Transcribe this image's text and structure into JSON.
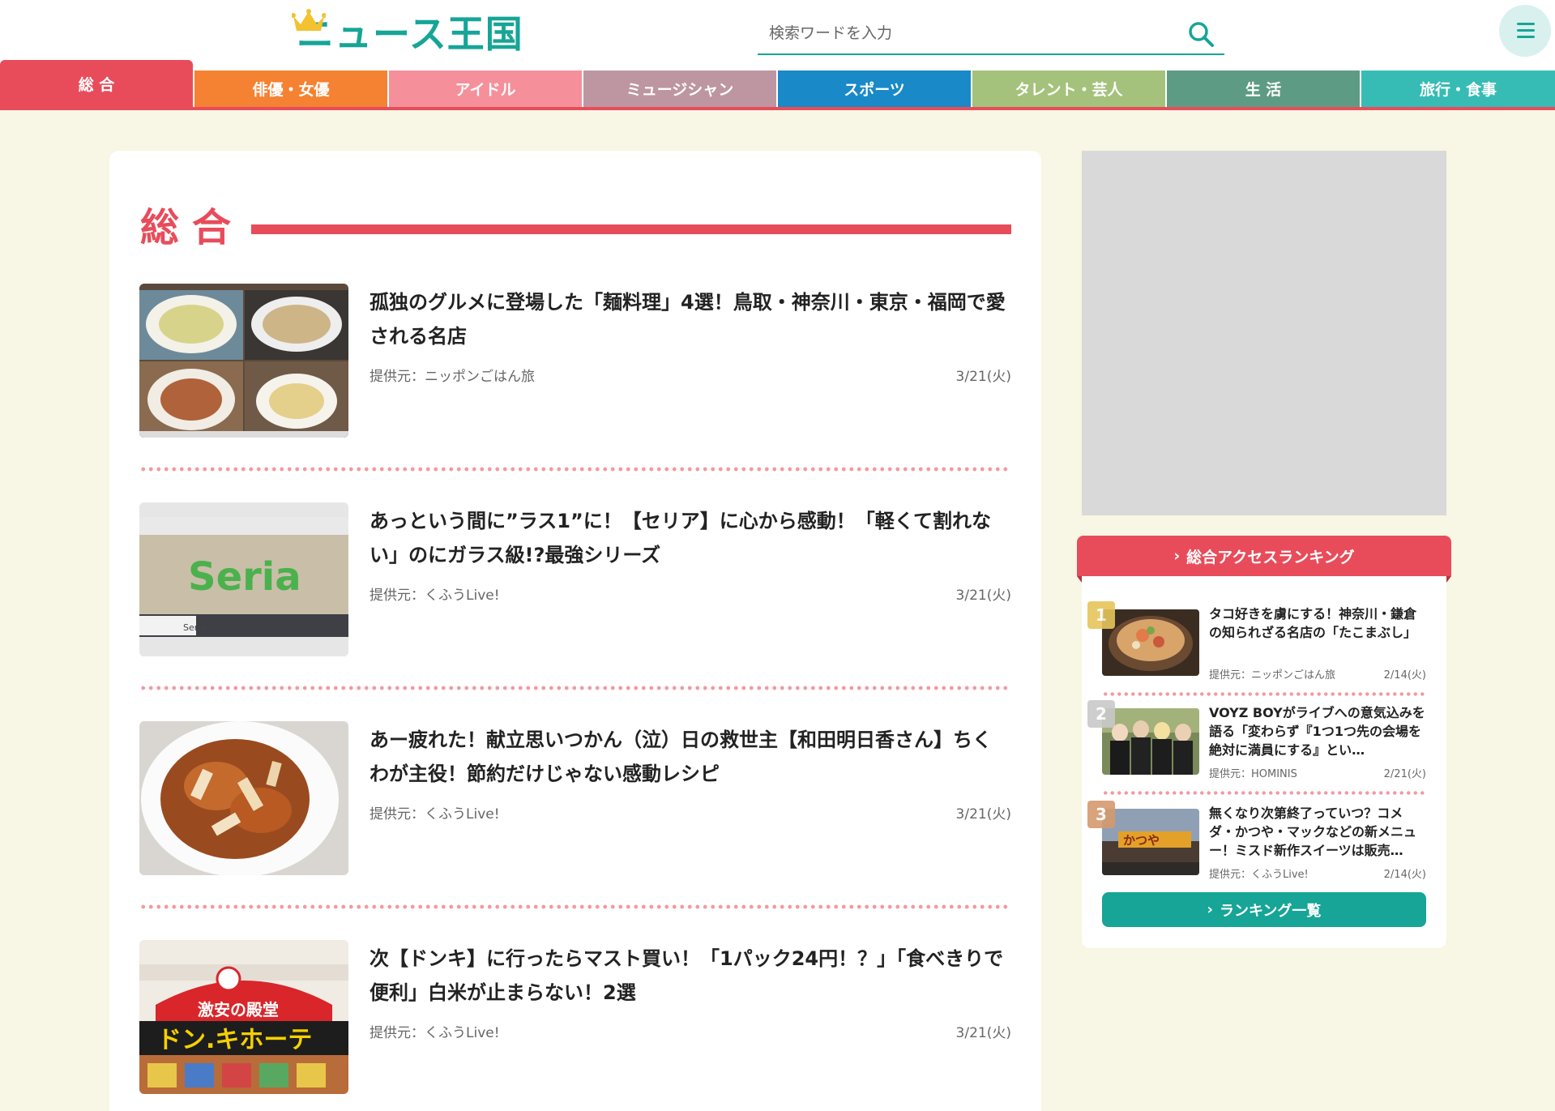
{
  "logo": {
    "text": "ニュース王国",
    "crown_color": "#f2c230"
  },
  "search": {
    "placeholder": "検索ワードを入力"
  },
  "nav": {
    "tabs": [
      {
        "label": "総 合",
        "color": "#e84c5a",
        "active": true
      },
      {
        "label": "俳優・女優",
        "color": "#f58232"
      },
      {
        "label": "アイドル",
        "color": "#f5909b"
      },
      {
        "label": "ミュージシャン",
        "color": "#bd96a1"
      },
      {
        "label": "スポーツ",
        "color": "#1989c7"
      },
      {
        "label": "タレント・芸人",
        "color": "#a4c27c"
      },
      {
        "label": "生 活",
        "color": "#5e9b84"
      },
      {
        "label": "旅行・食事",
        "color": "#36bcb4"
      }
    ]
  },
  "main": {
    "section_title": "総合",
    "articles": [
      {
        "title": "孤独のグルメに登場した「麺料理」4選！鳥取・神奈川・東京・福岡で愛される名店",
        "source": "提供元：ニッポンごはん旅",
        "date": "3/21(火)"
      },
      {
        "title": "あっという間に”ラス1”に！【セリア】に心から感動！「軽くて割れない」のにガラス級!?最強シリーズ",
        "source": "提供元：くふうLive!",
        "date": "3/21(火)"
      },
      {
        "title": "あー疲れた！献立思いつかん（泣）日の救世主【和田明日香さん】ちくわが主役！節約だけじゃない感動レシピ",
        "source": "提供元：くふうLive!",
        "date": "3/21(火)"
      },
      {
        "title": "次【ドンキ】に行ったらマスト買い！「1パック24円！？」「食べきりで便利」白米が止まらない！2選",
        "source": "提供元：くふうLive!",
        "date": "3/21(火)"
      }
    ],
    "thumb_texts": {
      "seria": "Seria",
      "seria_small": "Seria",
      "donki_top": "激安の殿堂",
      "donki_main": "ドン.キホーテ"
    }
  },
  "ranking": {
    "header": "総合アクセスランキング",
    "items": [
      {
        "rank": "1",
        "badge_color": "#e6c55a",
        "title": "タコ好きを虜にする！神奈川・鎌倉の知られざる名店の「たこまぶし」",
        "source": "提供元：ニッポンごはん旅",
        "date": "2/14(火)"
      },
      {
        "rank": "2",
        "badge_color": "#c9c9c9",
        "title": "VOYZ BOYがライブへの意気込みを語る「変わらず『1つ1つ先の会場を絶対に満員にする』とい…",
        "source": "提供元：HOMINIS",
        "date": "2/21(火)"
      },
      {
        "rank": "3",
        "badge_color": "#d59a6e",
        "title": "無くなり次第終了っていつ？コメダ・かつや・マックなどの新メニュー！ミスド新作スイーツは販売…",
        "source": "提供元：くふうLive!",
        "date": "2/14(火)"
      }
    ],
    "all_button": "ランキング一覧",
    "thumb_text_3": "かつや"
  }
}
